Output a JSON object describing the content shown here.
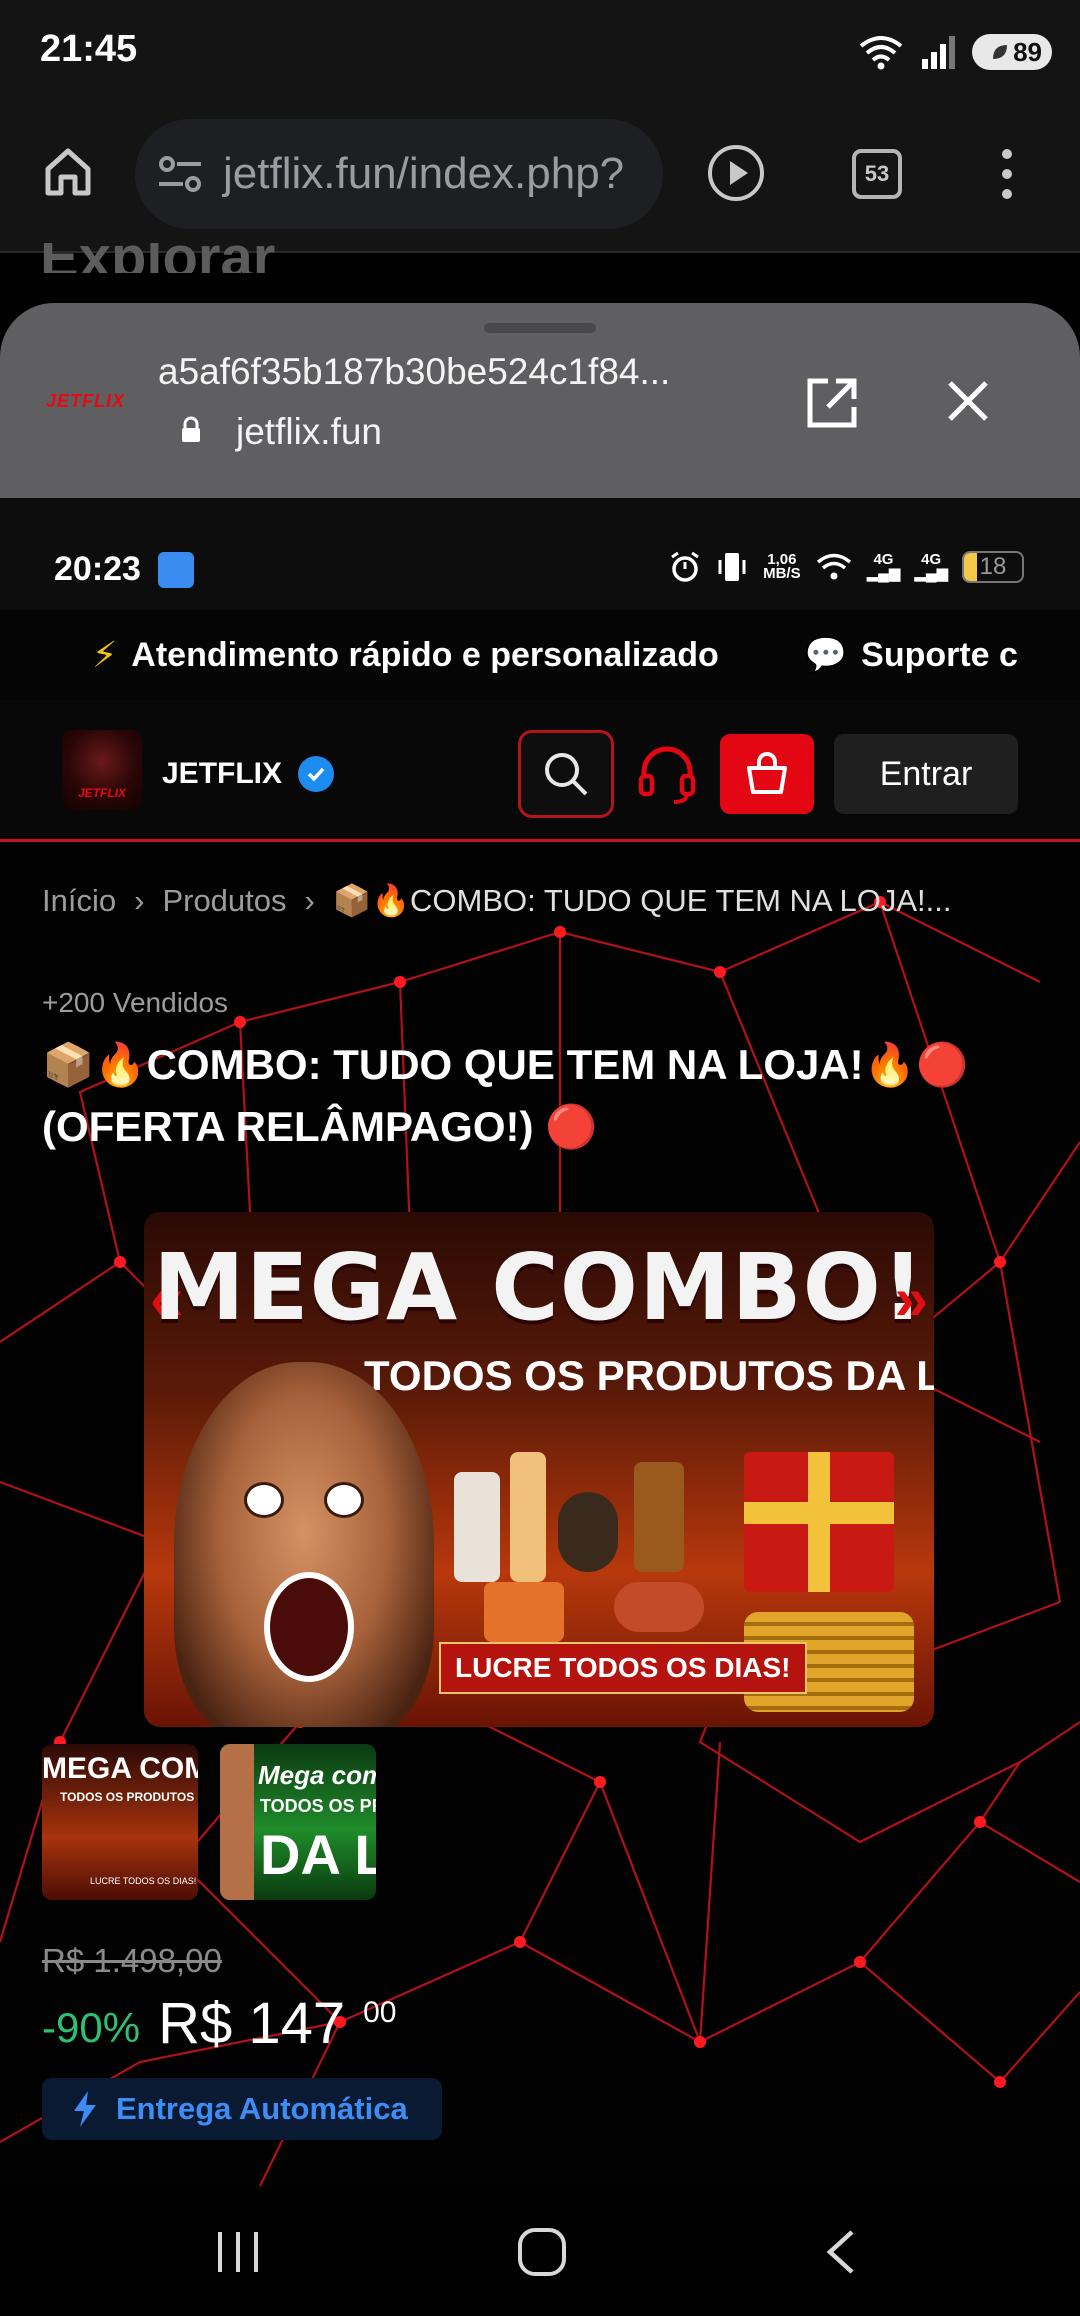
{
  "status_bar": {
    "time": "21:45",
    "battery": "89"
  },
  "browser": {
    "url": "jetflix.fun/index.php?",
    "tab_count": "53",
    "behind_heading": "Explorar"
  },
  "sheet": {
    "logo_text": "JETFLIX",
    "title": "a5af6f35b187b30be524c1f84...",
    "domain": "jetflix.fun"
  },
  "inner_status": {
    "time": "20:23",
    "net_speed_top": "1,06",
    "net_speed_bottom": "MB/S",
    "sig1": "4G",
    "sig2": "4G",
    "battery": "18"
  },
  "ticker": {
    "items": [
      "Atendimento rápido e personalizado",
      "Suporte c"
    ]
  },
  "header": {
    "avatar_text": "JETFLIX",
    "brand": "JETFLIX",
    "login_label": "Entrar"
  },
  "breadcrumb": {
    "home": "Início",
    "products": "Produtos",
    "current": "📦🔥COMBO: TUDO QUE TEM NA LOJA!..."
  },
  "product": {
    "sold": "+200 Vendidos",
    "title": "📦🔥COMBO: TUDO QUE TEM NA LOJA!🔥🔴 (OFERTA RELÂMPAGO!) 🔴",
    "image": {
      "headline": "MEGA COMBO!",
      "subline": "TODOS OS PRODUTOS DA LOJA",
      "badge": "LUCRE TODOS OS DIAS!",
      "chevrons_left": "«",
      "chevrons_right": "»"
    },
    "thumb1": {
      "title": "MEGA COMBO",
      "sub": "TODOS OS PRODUTOS DA",
      "foot": "LUCRE TODOS OS DIAS!"
    },
    "thumb2": {
      "line1": "Mega com",
      "line2": "TODOS OS PROD",
      "line3": "DA LOJ"
    },
    "old_price": "R$ 1.498,00",
    "discount": "-90%",
    "price": "R$ 147",
    "price_cents": "00",
    "delivery": "Entrega Automática"
  },
  "colors": {
    "accent_red": "#e30613",
    "discount_green": "#2fbf71",
    "delivery_blue": "#3d8df5",
    "verified_blue": "#1d8cf0"
  }
}
